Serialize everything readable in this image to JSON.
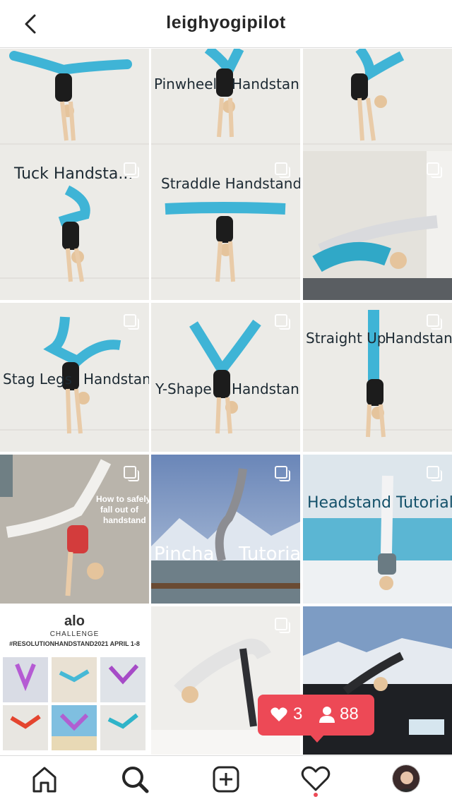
{
  "header": {
    "title": "leighyogipilot"
  },
  "tiles": {
    "t2": {
      "left": "Pinwheel",
      "right": "Handstand"
    },
    "t4": {
      "caption": "Tuck Handsta..."
    },
    "t5": {
      "caption": "Straddle Handstand"
    },
    "t7": {
      "left": "Stag Legs",
      "right": "Handstand"
    },
    "t8": {
      "left": "Y-Shape",
      "right": "Handstand"
    },
    "t9": {
      "left": "Straight Up",
      "right": "Handstand"
    },
    "t10": {
      "l1": "How to safely",
      "l2": "fall out of",
      "l3": "handstand"
    },
    "t11": {
      "left": "Pincha",
      "right": "Tutorial"
    },
    "t12": {
      "left": "Headstand",
      "right": "Tutorial"
    },
    "t13": {
      "brand": "alo",
      "sub": "CHALLENGE",
      "hashtag": "#RESOLUTIONHANDSTAND2021 APRIL 1-8"
    }
  },
  "popup": {
    "likes": "3",
    "followers": "88"
  },
  "colors": {
    "accent": "#ed4956",
    "teal": "#14516a",
    "legging": "#3fb4d6"
  },
  "nav": {
    "items": [
      "home-icon",
      "search-icon",
      "add-post-icon",
      "activity-heart-icon",
      "profile-avatar"
    ]
  }
}
